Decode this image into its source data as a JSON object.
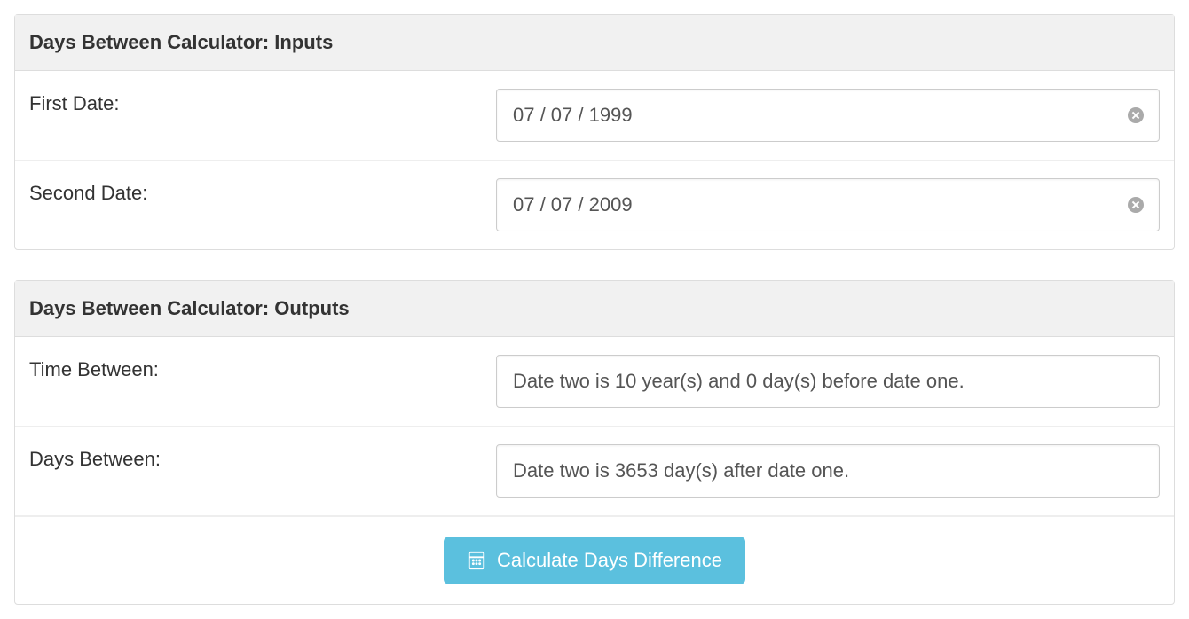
{
  "inputs": {
    "header": "Days Between Calculator: Inputs",
    "first_date": {
      "label": "First Date:",
      "value": "07 / 07 / 1999"
    },
    "second_date": {
      "label": "Second Date:",
      "value": "07 / 07 / 2009"
    }
  },
  "outputs": {
    "header": "Days Between Calculator: Outputs",
    "time_between": {
      "label": "Time Between:",
      "value": "Date two is 10 year(s) and 0 day(s) before date one."
    },
    "days_between": {
      "label": "Days Between:",
      "value": "Date two is 3653 day(s) after date one."
    },
    "button_label": "Calculate Days Difference"
  }
}
